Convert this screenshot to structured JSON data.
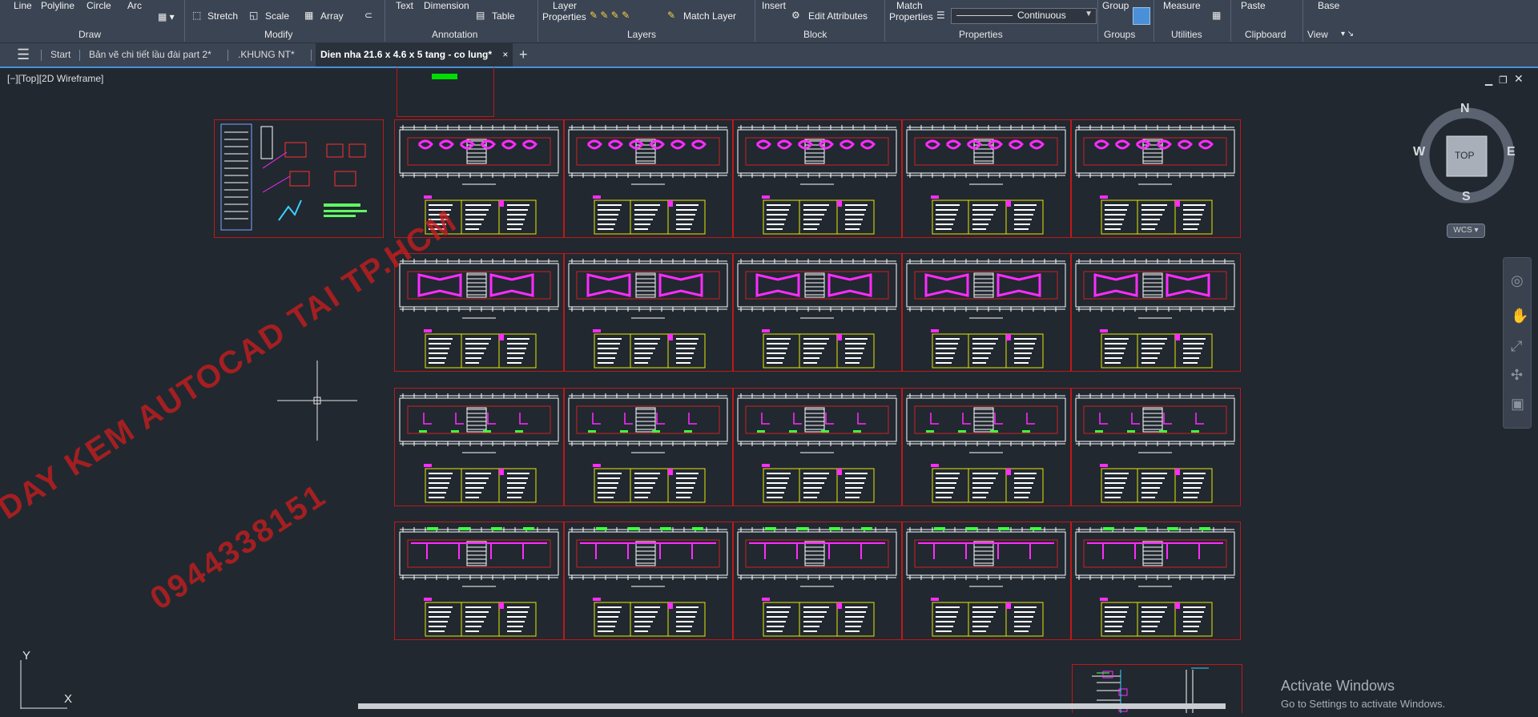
{
  "ribbon": {
    "draw_row1": [
      "Line",
      "Polyline",
      "Circle",
      "Arc"
    ],
    "modify_row": [
      "Stretch",
      "Scale",
      "Array"
    ],
    "annotation_row1": [
      "Text",
      "Dimension"
    ],
    "annotation_table": "Table",
    "layers": {
      "layer_properties_1": "Layer",
      "layer_properties_2": "Properties",
      "match_layer": "Match Layer"
    },
    "block": {
      "insert": "Insert",
      "edit_attributes": "Edit Attributes"
    },
    "properties": {
      "match_1": "Match",
      "match_2": "Properties",
      "linetype": "Continuous"
    },
    "groups": {
      "group": "Group"
    },
    "utilities": {
      "measure": "Measure"
    },
    "clipboard": {
      "paste": "Paste"
    },
    "view": {
      "base": "Base"
    },
    "panels": [
      "Draw",
      "Modify",
      "Annotation",
      "Layers",
      "Block",
      "Properties",
      "Groups",
      "Utilities",
      "Clipboard",
      "View"
    ]
  },
  "tabs": {
    "start": "Start",
    "tab1": "Bản vẽ chi tiết lầu đài part 2*",
    "tab2": ".KHUNG NT*",
    "tab3": "Dien nha 21.6 x 4.6 x 5 tang - co lung*"
  },
  "viewport": {
    "label": "[−][Top][2D Wireframe]",
    "viewcube": {
      "n": "N",
      "s": "S",
      "e": "E",
      "w": "W",
      "top": "TOP",
      "wcs": "WCS"
    },
    "ucs": {
      "y": "Y",
      "x": "X"
    }
  },
  "watermark": {
    "line1": "DAY KEM AUTOCAD TAI TP.HCM",
    "line2": "0944338151"
  },
  "activation": {
    "title": "Activate Windows",
    "subtitle": "Go to Settings to activate Windows."
  },
  "colors": {
    "ribbon": "#3b4453",
    "canvas": "#212830",
    "sheet_border": "#c01818",
    "magenta": "#ff2bff",
    "yellow": "#e8e800",
    "accent": "#4a90d9"
  }
}
